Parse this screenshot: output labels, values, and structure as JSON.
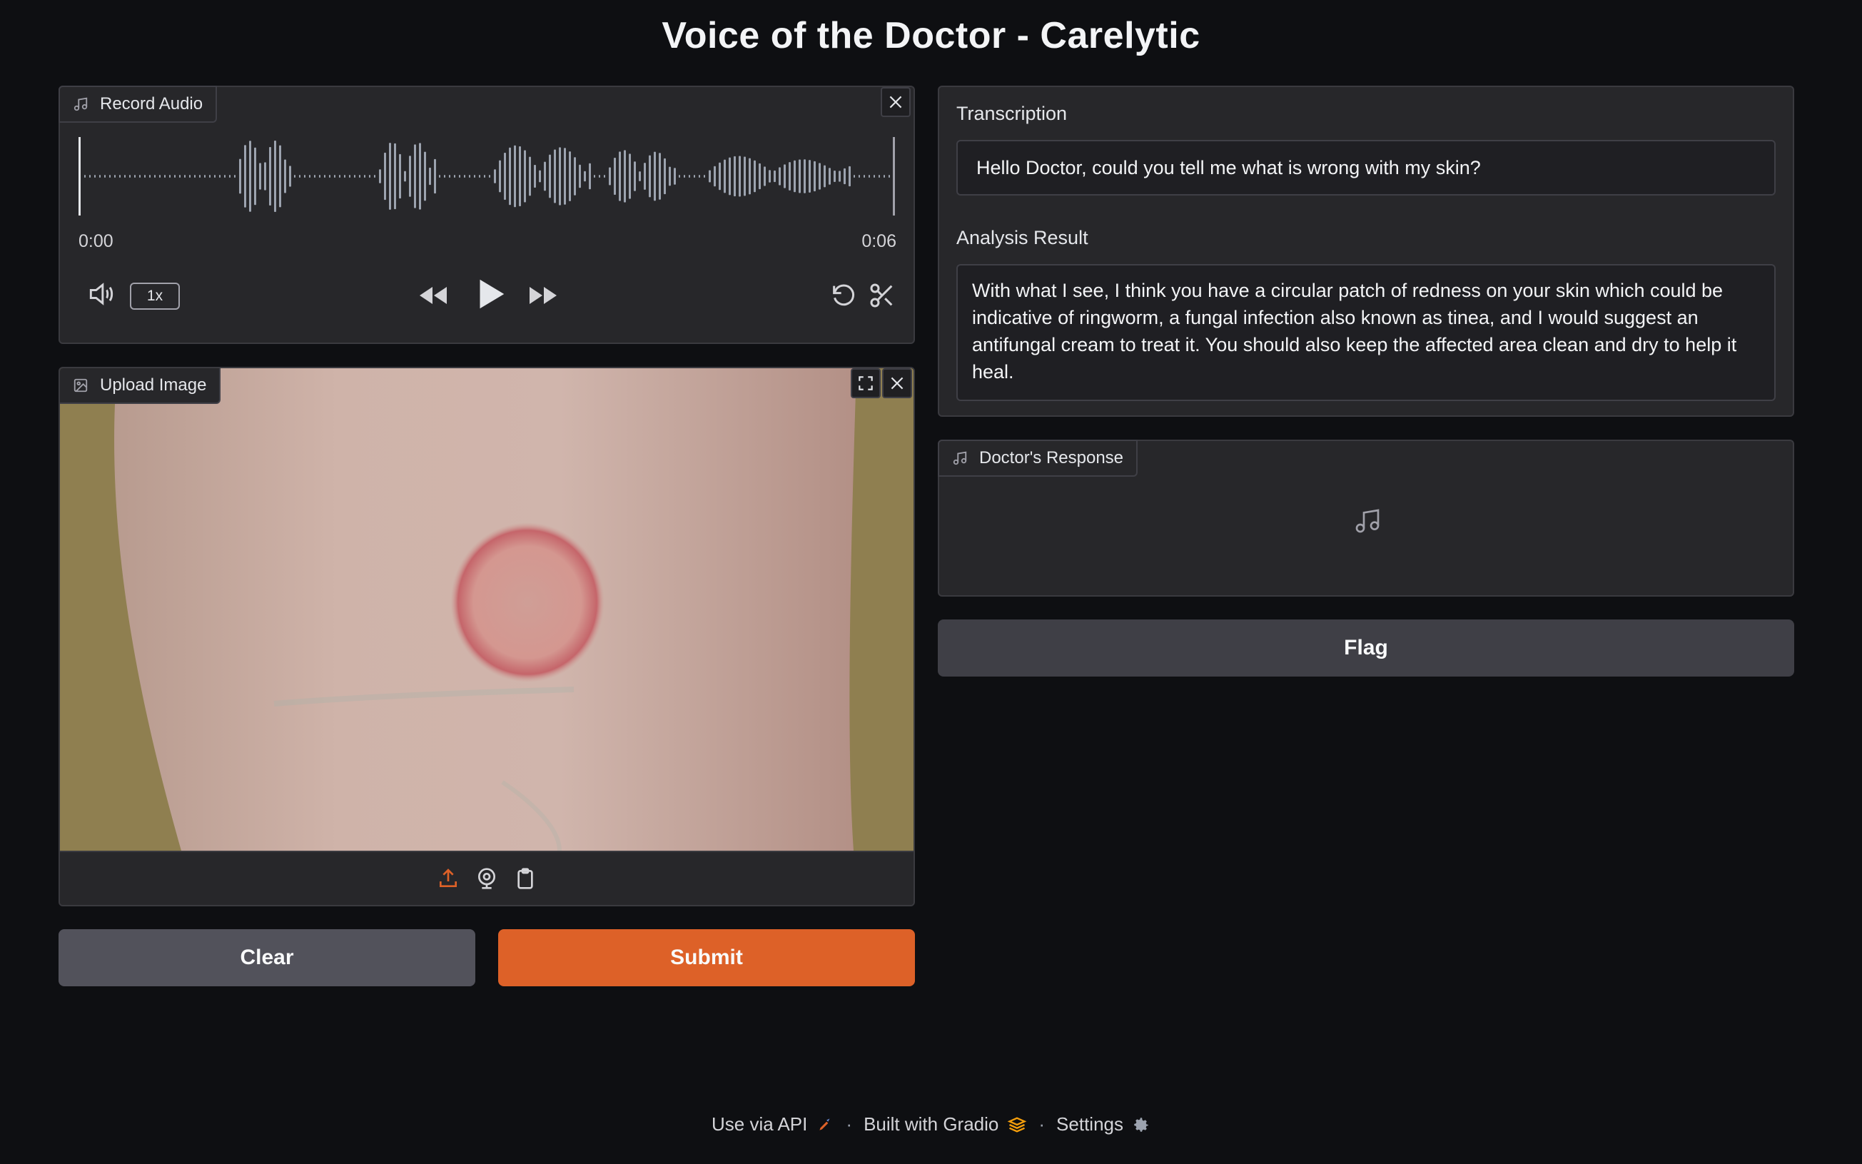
{
  "page": {
    "title": "Voice of the Doctor - Carelytic"
  },
  "audio_input": {
    "label": "Record Audio",
    "current_time": "0:00",
    "duration": "0:06",
    "playback_speed": "1x"
  },
  "image_input": {
    "label": "Upload Image"
  },
  "buttons": {
    "clear": "Clear",
    "submit": "Submit",
    "flag": "Flag"
  },
  "transcription": {
    "label": "Transcription",
    "value": "Hello Doctor, could you tell me what is wrong with my skin?"
  },
  "analysis": {
    "label": "Analysis Result",
    "value": "With what I see, I think you have a circular patch of redness on your skin which could be indicative of ringworm, a fungal infection also known as tinea, and I would suggest an antifungal cream to treat it. You should also keep the affected area clean and dry to help it heal."
  },
  "doctor_response": {
    "label": "Doctor's Response"
  },
  "footer": {
    "api": "Use via API",
    "built": "Built with Gradio",
    "settings": "Settings"
  },
  "colors": {
    "accent": "#dd6128",
    "background": "#0e0f12",
    "panel": "#27272a"
  }
}
